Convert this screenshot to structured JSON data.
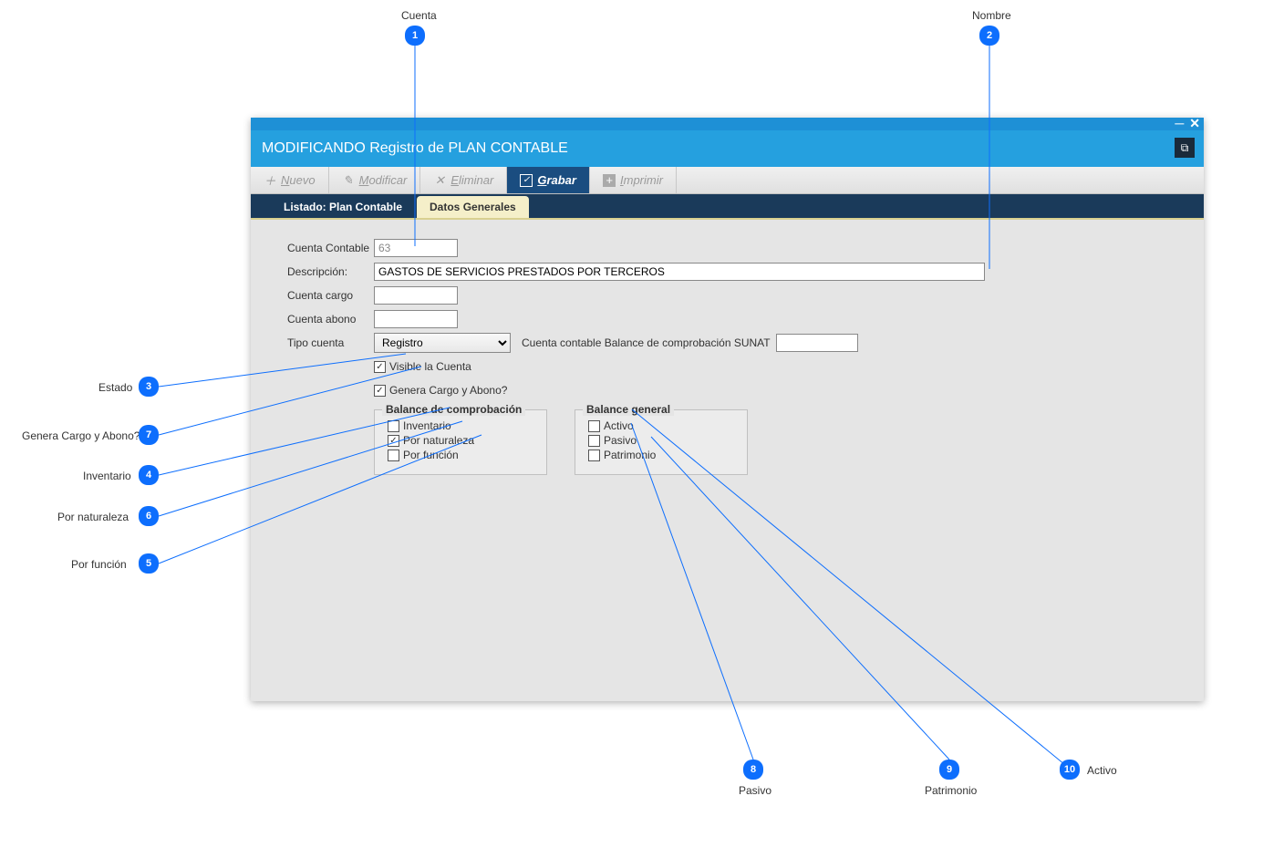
{
  "callouts": {
    "c1": {
      "label": "Cuenta",
      "num": "1"
    },
    "c2": {
      "label": "Nombre",
      "num": "2"
    },
    "c3": {
      "label": "Estado",
      "num": "3"
    },
    "c4": {
      "label": "Inventario",
      "num": "4"
    },
    "c5": {
      "label": "Por función",
      "num": "5"
    },
    "c6": {
      "label": "Por naturaleza",
      "num": "6"
    },
    "c7": {
      "label": "Genera Cargo y Abono?",
      "num": "7"
    },
    "c8": {
      "label": "Pasivo",
      "num": "8"
    },
    "c9": {
      "label": "Patrimonio",
      "num": "9"
    },
    "c10": {
      "label": "Activo",
      "num": "10"
    }
  },
  "window": {
    "title": "MODIFICANDO Registro de PLAN CONTABLE"
  },
  "toolbar": {
    "nuevo": "Nuevo",
    "modificar": "Modificar",
    "eliminar": "Eliminar",
    "grabar": "Grabar",
    "imprimir": "Imprimir"
  },
  "tabs": {
    "listado": "Listado: Plan Contable",
    "datos": "Datos Generales"
  },
  "form": {
    "labels": {
      "cuenta": "Cuenta Contable",
      "descripcion": "Descripción:",
      "cargo": "Cuenta cargo",
      "abono": "Cuenta abono",
      "tipo": "Tipo cuenta",
      "sunat": "Cuenta contable Balance de comprobación SUNAT"
    },
    "values": {
      "cuenta": "63",
      "descripcion": "GASTOS DE SERVICIOS PRESTADOS POR TERCEROS",
      "cargo": "",
      "abono": "",
      "tipo": "Registro",
      "sunat": ""
    },
    "checks": {
      "visible": "Visible la Cuenta",
      "genera": "Genera Cargo y Abono?"
    },
    "group_comprobacion": {
      "title": "Balance de comprobación",
      "inventario": "Inventario",
      "naturaleza": "Por naturaleza",
      "funcion": "Por función"
    },
    "group_general": {
      "title": "Balance general",
      "activo": "Activo",
      "pasivo": "Pasivo",
      "patrimonio": "Patrimonio"
    }
  }
}
